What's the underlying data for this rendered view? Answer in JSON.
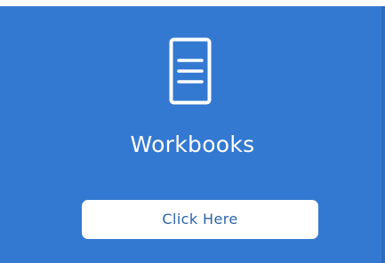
{
  "card": {
    "icon": "document-lines-icon",
    "title": "Workbooks",
    "button_label": "Click Here"
  },
  "colors": {
    "card_background": "#3479d1",
    "icon_and_title": "#ffffff",
    "button_background": "#ffffff",
    "button_text": "#2c64ad"
  }
}
